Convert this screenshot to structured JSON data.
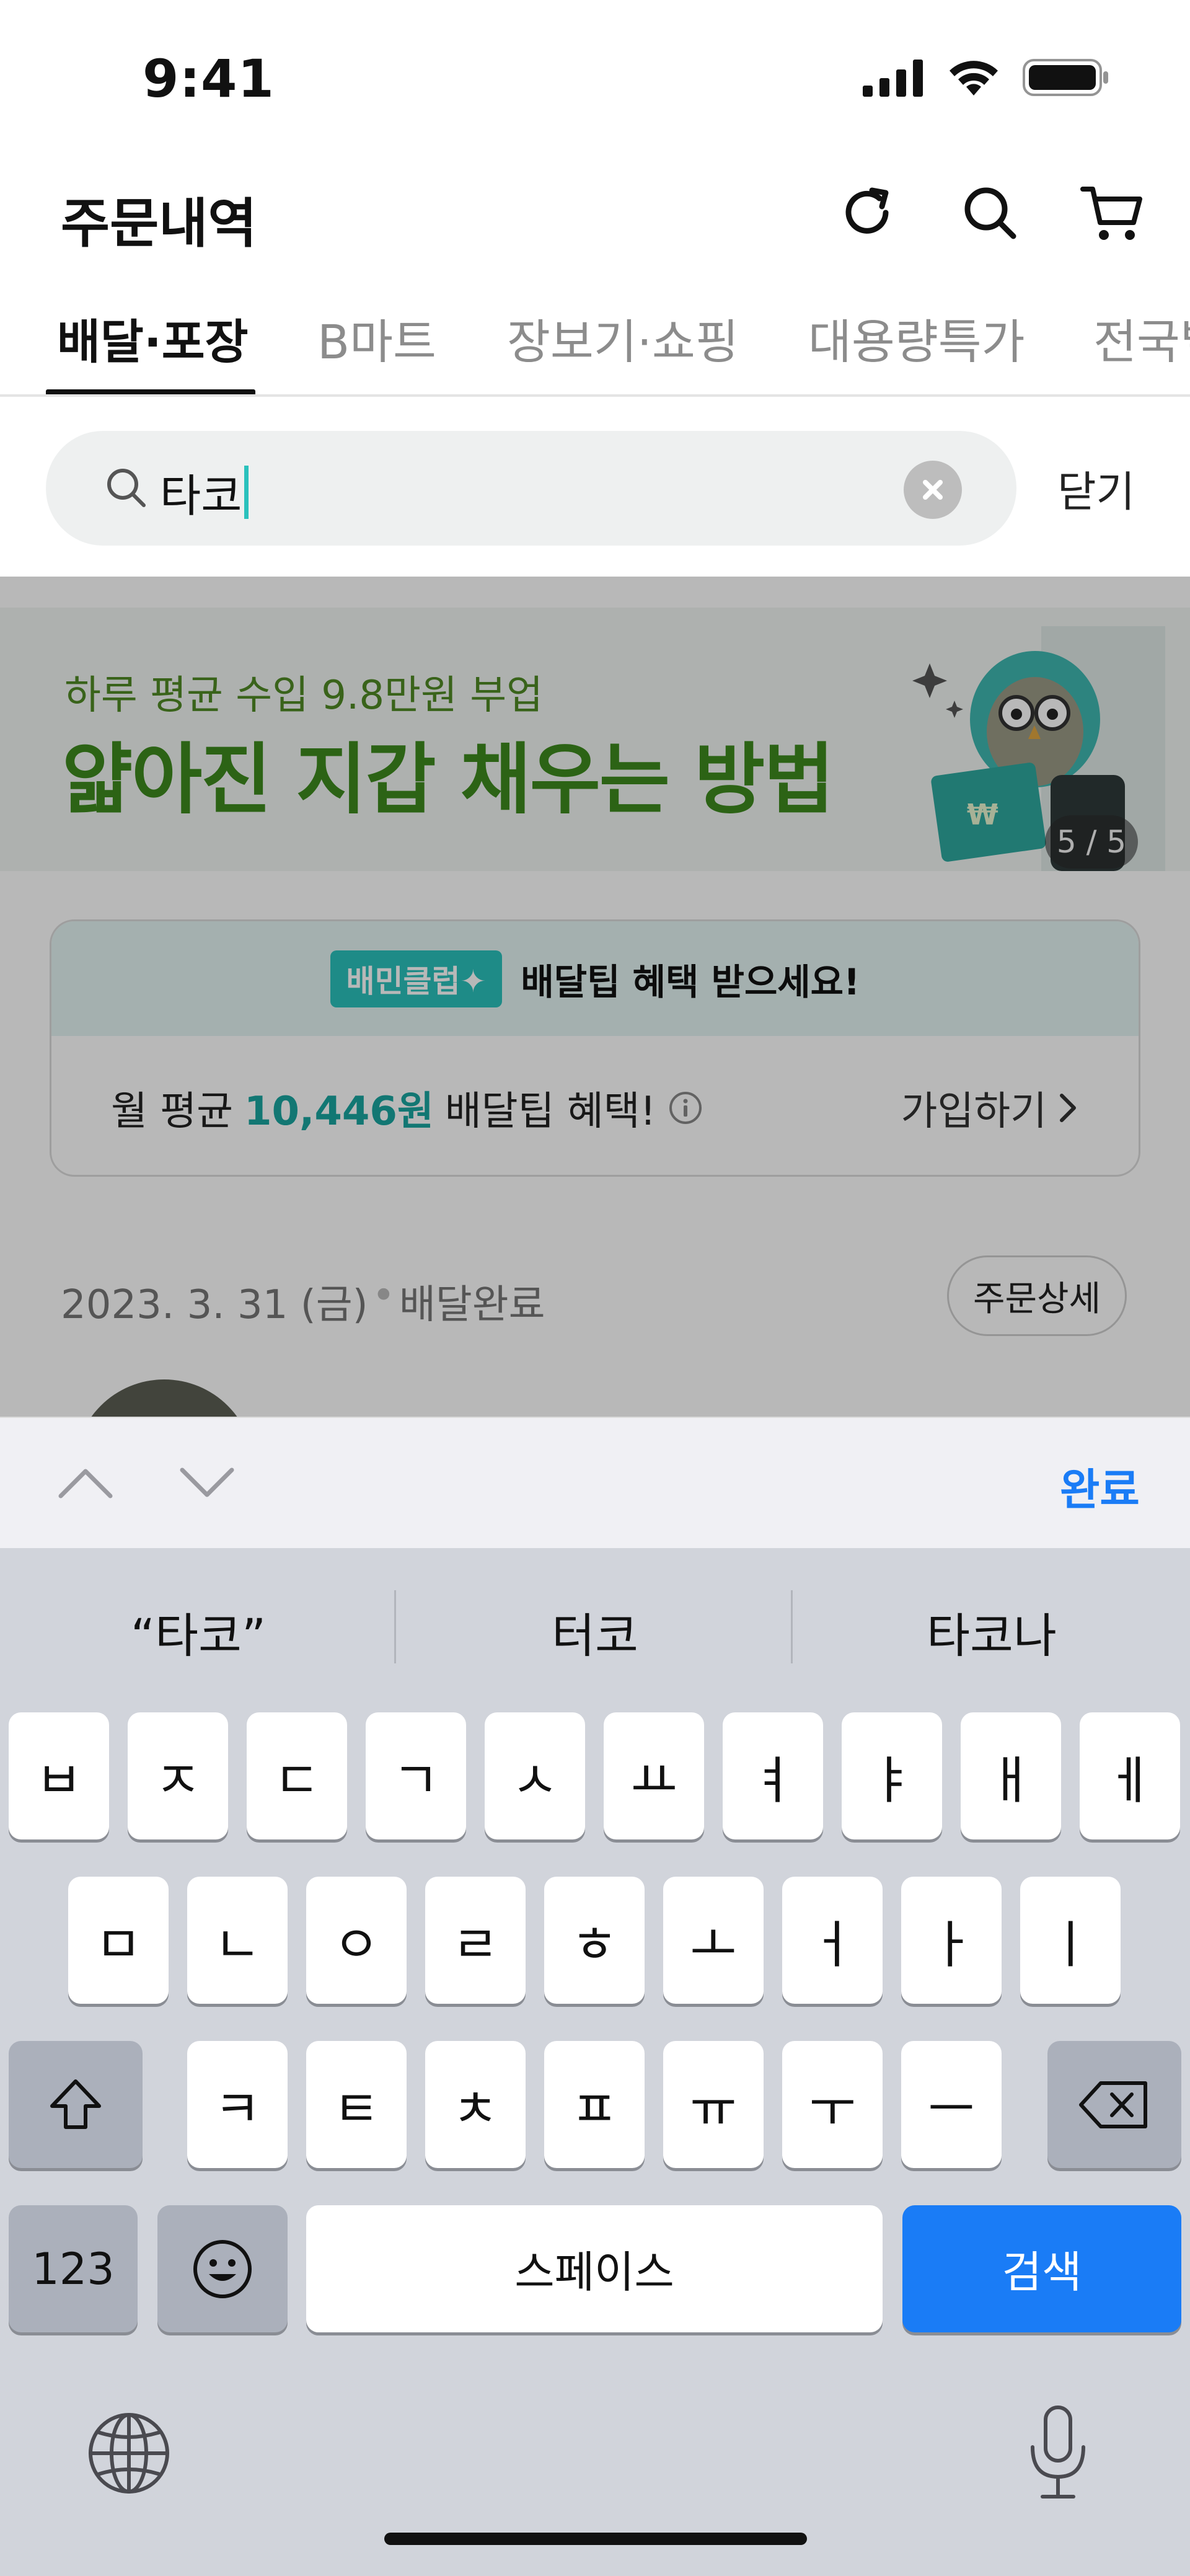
{
  "status_bar": {
    "time": "9:41"
  },
  "header": {
    "title": "주문내역",
    "icons": [
      "refresh-icon",
      "search-icon",
      "cart-icon"
    ]
  },
  "tabs": [
    {
      "label": "배달·포장",
      "active": true
    },
    {
      "label": "B마트",
      "active": false
    },
    {
      "label": "장보기·쇼핑",
      "active": false
    },
    {
      "label": "대용량특가",
      "active": false
    },
    {
      "label": "전국별미",
      "active": false
    }
  ],
  "search": {
    "value": "타코",
    "close_label": "닫기"
  },
  "banner": {
    "subtitle": "하루 평균 수입 9.8만원 부업",
    "title": "얇아진 지갑 채우는 방법",
    "counter": "5 / 5"
  },
  "club_card": {
    "badge": "배민클럽✦",
    "headline": "배달팁 혜택 받으세요!",
    "benefit_prefix": "월 평균",
    "benefit_amount": "10,446원",
    "benefit_suffix": "배달팁 혜택!",
    "join_label": "가입하기"
  },
  "order": {
    "date": "2023. 3. 31 (금)",
    "separator": "•",
    "status": "배달완료",
    "detail_button": "주문상세"
  },
  "keyboard": {
    "done_label": "완료",
    "suggestions": [
      "“타코”",
      "터코",
      "타코나"
    ],
    "row1": [
      "ㅂ",
      "ㅈ",
      "ㄷ",
      "ㄱ",
      "ㅅ",
      "ㅛ",
      "ㅕ",
      "ㅑ",
      "ㅐ",
      "ㅔ"
    ],
    "row2": [
      "ㅁ",
      "ㄴ",
      "ㅇ",
      "ㄹ",
      "ㅎ",
      "ㅗ",
      "ㅓ",
      "ㅏ",
      "ㅣ"
    ],
    "row3": [
      "ㅋ",
      "ㅌ",
      "ㅊ",
      "ㅍ",
      "ㅠ",
      "ㅜ",
      "ㅡ"
    ],
    "numbers_label": "123",
    "space_label": "스페이스",
    "search_label": "검색"
  },
  "colors": {
    "accent_mint": "#2ac1bc",
    "banner_green": "#3d8a1e",
    "ios_blue": "#1a7cf6"
  }
}
